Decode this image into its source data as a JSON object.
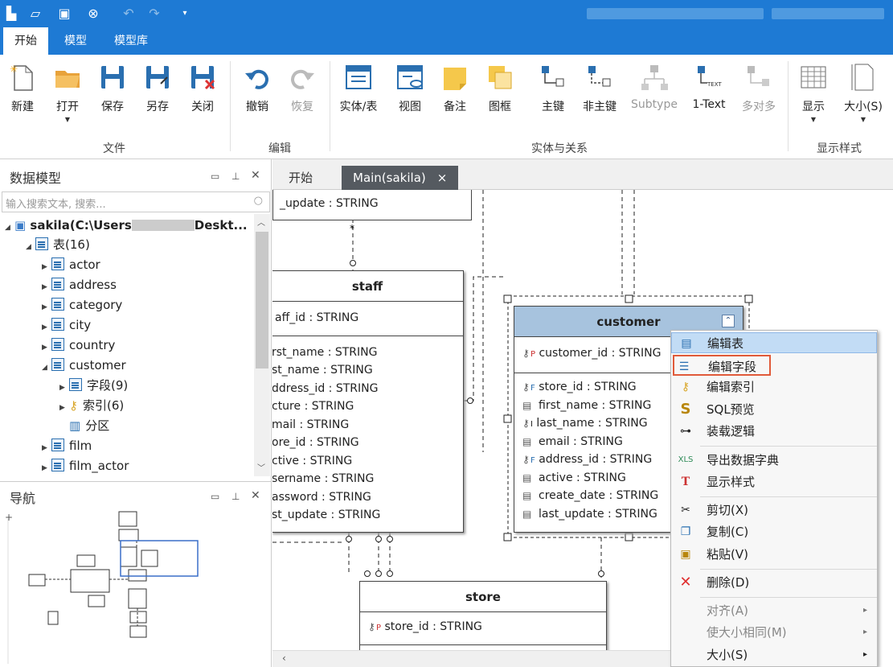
{
  "quick_access": [
    "new-icon",
    "open-icon",
    "save-icon",
    "close-icon",
    "undo-icon",
    "redo-icon",
    "dropdown-icon"
  ],
  "menu_tabs": [
    "开始",
    "模型",
    "模型库"
  ],
  "ribbon": {
    "buttons": [
      {
        "label": "新建"
      },
      {
        "label": "打开"
      },
      {
        "label": "保存"
      },
      {
        "label": "另存"
      },
      {
        "label": "关闭"
      },
      {
        "label": "撤销"
      },
      {
        "label": "恢复"
      },
      {
        "label": "实体/表"
      },
      {
        "label": "视图"
      },
      {
        "label": "备注"
      },
      {
        "label": "图框"
      },
      {
        "label": "主键"
      },
      {
        "label": "非主键"
      },
      {
        "label": "Subtype"
      },
      {
        "label": "1-Text"
      },
      {
        "label": "多对多"
      },
      {
        "label": "显示"
      },
      {
        "label": "大小(S)"
      }
    ],
    "groups": [
      "文件",
      "编辑",
      "实体与关系",
      "显示样式"
    ]
  },
  "left_panel": {
    "title": "数据模型",
    "search_placeholder": "输入搜索文本, 搜索...",
    "tree": [
      {
        "label": "sakila(C:\\Users",
        "suffix": "Deskt..."
      },
      {
        "label": "表(16)"
      },
      {
        "label": "actor"
      },
      {
        "label": "address"
      },
      {
        "label": "category"
      },
      {
        "label": "city"
      },
      {
        "label": "country"
      },
      {
        "label": "customer"
      },
      {
        "label": "字段(9)"
      },
      {
        "label": "索引(6)"
      },
      {
        "label": "分区"
      },
      {
        "label": "film"
      },
      {
        "label": "film_actor"
      }
    ]
  },
  "nav_panel": {
    "title": "导航",
    "plus": "+"
  },
  "doc_tabs": [
    {
      "label": "开始"
    },
    {
      "label": "Main(sakila)",
      "close": "×"
    }
  ],
  "entities": {
    "top_stub": {
      "fields": [
        "_update : STRING"
      ]
    },
    "staff": {
      "name": "staff",
      "pk": [
        "aff_id : STRING"
      ],
      "fields": [
        "rst_name : STRING",
        "st_name : STRING",
        "ddress_id : STRING",
        "cture : STRING",
        "mail : STRING",
        "ore_id : STRING",
        "ctive : STRING",
        "sername : STRING",
        "assword : STRING",
        "st_update : STRING"
      ]
    },
    "customer": {
      "name": "customer",
      "pk": [
        "customer_id : STRING"
      ],
      "fields": [
        "store_id : STRING",
        "first_name : STRING",
        "last_name : STRING",
        "email : STRING",
        "address_id : STRING",
        "active : STRING",
        "create_date : STRING",
        "last_update : STRING"
      ]
    },
    "store": {
      "name": "store",
      "pk": [
        "store_id : STRING"
      ]
    }
  },
  "context_menu": [
    {
      "label": "编辑表",
      "icon": "table-icon",
      "state": "highlighted"
    },
    {
      "label": "编辑字段",
      "icon": "fields-icon",
      "state": "boxed"
    },
    {
      "label": "编辑索引",
      "icon": "index-key-icon"
    },
    {
      "label": "SQL预览",
      "icon": "sql-icon"
    },
    {
      "label": "装载逻辑",
      "icon": "logic-icon"
    },
    {
      "label": "导出数据字典",
      "icon": "export-icon"
    },
    {
      "label": "显示样式",
      "icon": "style-icon"
    },
    {
      "label": "剪切(X)",
      "icon": "cut-icon"
    },
    {
      "label": "复制(C)",
      "icon": "copy-icon"
    },
    {
      "label": "粘贴(V)",
      "icon": "paste-icon"
    },
    {
      "label": "删除(D)",
      "icon": "delete-icon"
    },
    {
      "label": "对齐(A)",
      "state": "disabled",
      "submenu": "▸"
    },
    {
      "label": "使大小相同(M)",
      "state": "disabled",
      "submenu": "▸"
    },
    {
      "label": "大小(S)",
      "submenu": "▸"
    }
  ],
  "colors": {
    "titlebar": "#1e7ad4",
    "selected_header": "#a7c3de",
    "highlight": "#c2dcf5",
    "box": "#e05a3a"
  }
}
